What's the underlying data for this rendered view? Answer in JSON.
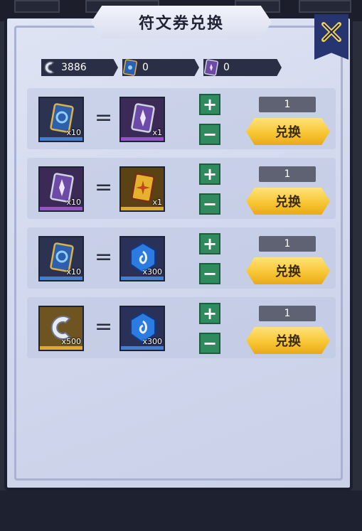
{
  "title": "符文券兑换",
  "currencies": [
    {
      "icon": "silver-hook-icon",
      "value": "3886"
    },
    {
      "icon": "blue-rune-ticket-icon",
      "value": "0"
    },
    {
      "icon": "purple-rune-ticket-icon",
      "value": "0"
    }
  ],
  "rows": [
    {
      "from": {
        "icon": "blue-rune-ticket-icon",
        "count": "x10"
      },
      "to": {
        "icon": "purple-rune-ticket-icon",
        "count": "x1"
      },
      "quantity": "1",
      "button": "兑换"
    },
    {
      "from": {
        "icon": "purple-rune-ticket-icon",
        "count": "x10"
      },
      "to": {
        "icon": "gold-rune-ticket-icon",
        "count": "x1"
      },
      "quantity": "1",
      "button": "兑换"
    },
    {
      "from": {
        "icon": "blue-rune-ticket-icon",
        "count": "x10"
      },
      "to": {
        "icon": "blue-gem-icon",
        "count": "x300"
      },
      "quantity": "1",
      "button": "兑换"
    },
    {
      "from": {
        "icon": "silver-hook-icon",
        "count": "x500"
      },
      "to": {
        "icon": "blue-gem-icon",
        "count": "x300"
      },
      "quantity": "1",
      "button": "兑换"
    }
  ],
  "symbols": {
    "equals": "=",
    "plus": "+",
    "minus": "−"
  },
  "colors": {
    "blue_rarity": "#3f7fd6",
    "purple_rarity": "#9a4fd0",
    "gold_rarity": "#e0a92a",
    "button_gold": "#f7c430",
    "plus_minus_green": "#2f8a5e"
  }
}
